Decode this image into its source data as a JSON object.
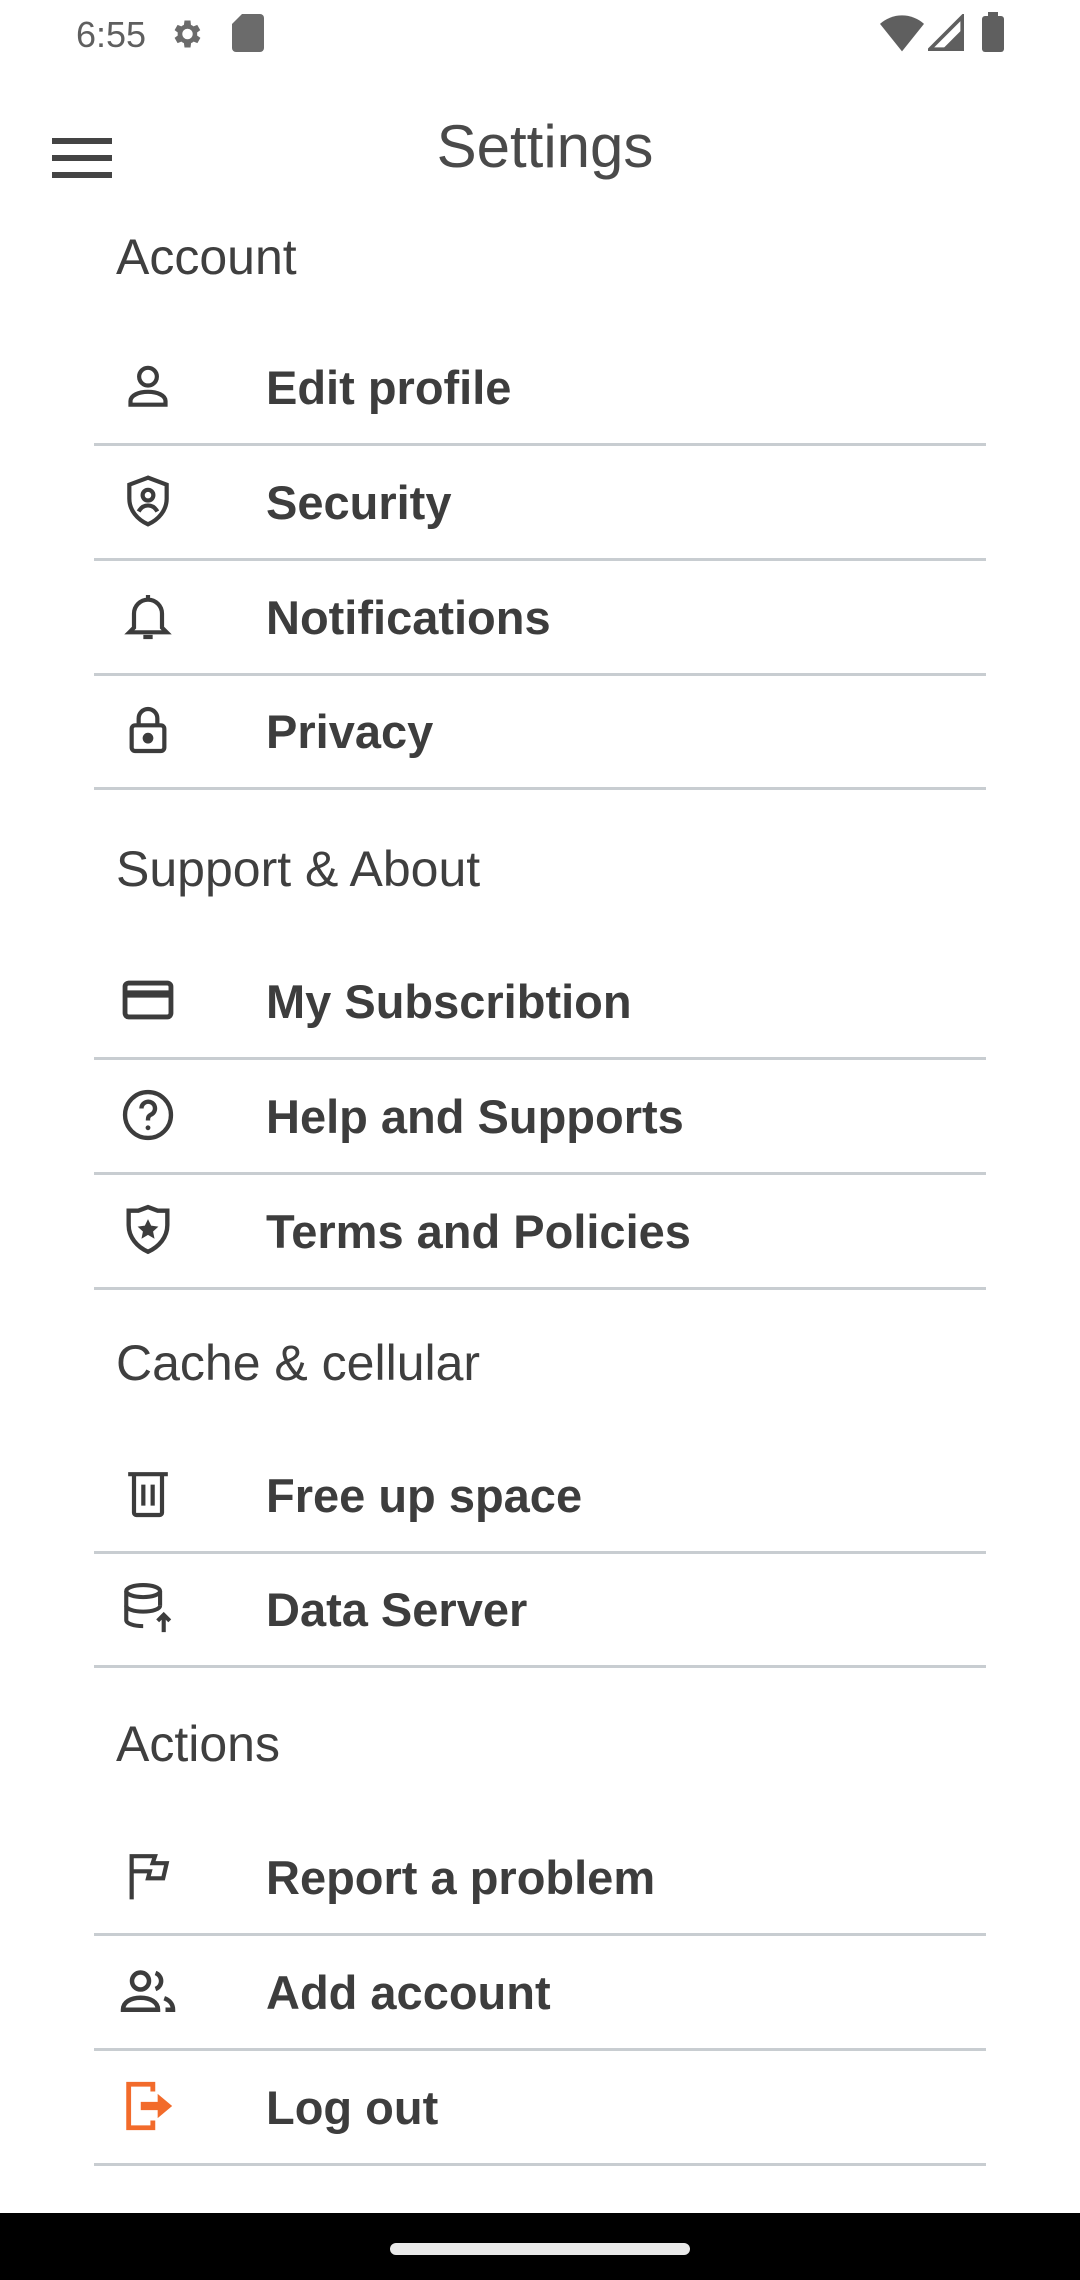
{
  "status_bar": {
    "time": "6:55",
    "icons": [
      "settings-gear-icon",
      "sd-card-icon",
      "wifi-icon",
      "signal-icon",
      "battery-icon"
    ]
  },
  "app_bar": {
    "title": "Settings",
    "menu_icon": "hamburger-menu-icon"
  },
  "sections": [
    {
      "title": "Account",
      "items": [
        {
          "label": "Edit profile",
          "icon": "person-icon"
        },
        {
          "label": "Security",
          "icon": "shield-icon"
        },
        {
          "label": "Notifications",
          "icon": "bell-icon"
        },
        {
          "label": "Privacy",
          "icon": "lock-icon"
        }
      ]
    },
    {
      "title": "Support & About",
      "items": [
        {
          "label": "My Subscribtion",
          "icon": "credit-card-icon"
        },
        {
          "label": "Help and Supports",
          "icon": "help-circle-icon"
        },
        {
          "label": "Terms and Policies",
          "icon": "badge-star-icon"
        }
      ]
    },
    {
      "title": "Cache & cellular",
      "items": [
        {
          "label": "Free up space",
          "icon": "trash-icon"
        },
        {
          "label": "Data Server",
          "icon": "database-upload-icon"
        }
      ]
    },
    {
      "title": "Actions",
      "items": [
        {
          "label": "Report a problem",
          "icon": "flag-icon"
        },
        {
          "label": "Add account",
          "icon": "people-icon"
        },
        {
          "label": "Log out",
          "icon": "logout-icon"
        }
      ]
    }
  ],
  "colors": {
    "logout_accent": "#f26b2b",
    "divider": "#c8cdd1",
    "icon": "#3c3c3c"
  }
}
